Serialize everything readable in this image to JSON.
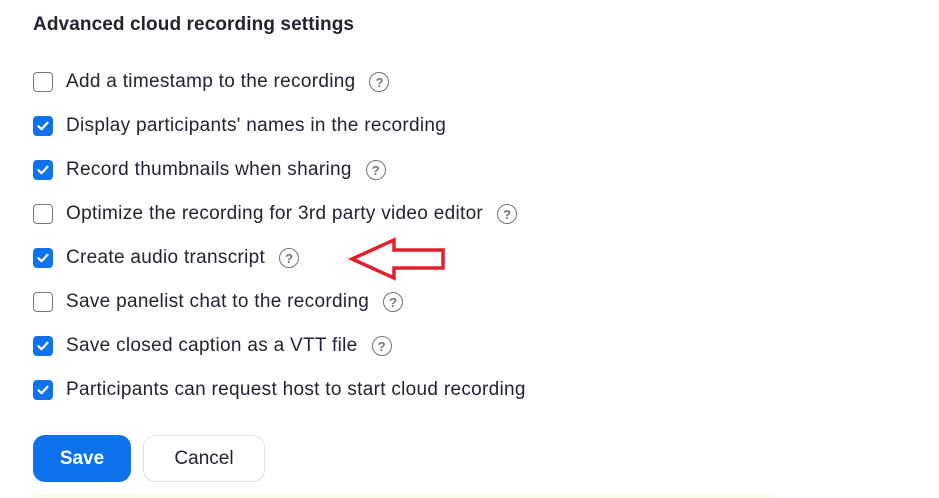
{
  "section": {
    "title": "Advanced cloud recording settings"
  },
  "options": [
    {
      "label": "Add a timestamp to the recording",
      "checked": false,
      "help": true
    },
    {
      "label": "Display participants' names in the recording",
      "checked": true,
      "help": false
    },
    {
      "label": "Record thumbnails when sharing",
      "checked": true,
      "help": true
    },
    {
      "label": "Optimize the recording for 3rd party video editor",
      "checked": false,
      "help": true
    },
    {
      "label": "Create audio transcript",
      "checked": true,
      "help": true
    },
    {
      "label": "Save panelist chat to the recording",
      "checked": false,
      "help": true
    },
    {
      "label": "Save closed caption as a VTT file",
      "checked": true,
      "help": true
    },
    {
      "label": "Participants can request host to start cloud recording",
      "checked": true,
      "help": false
    }
  ],
  "help_glyph": "?",
  "buttons": {
    "save": "Save",
    "cancel": "Cancel"
  },
  "colors": {
    "accent": "#0e72ed",
    "annotation": "#e0202b",
    "text": "#232333"
  },
  "annotation": {
    "type": "arrow-pointing-left",
    "target": "Create audio transcript help icon"
  }
}
